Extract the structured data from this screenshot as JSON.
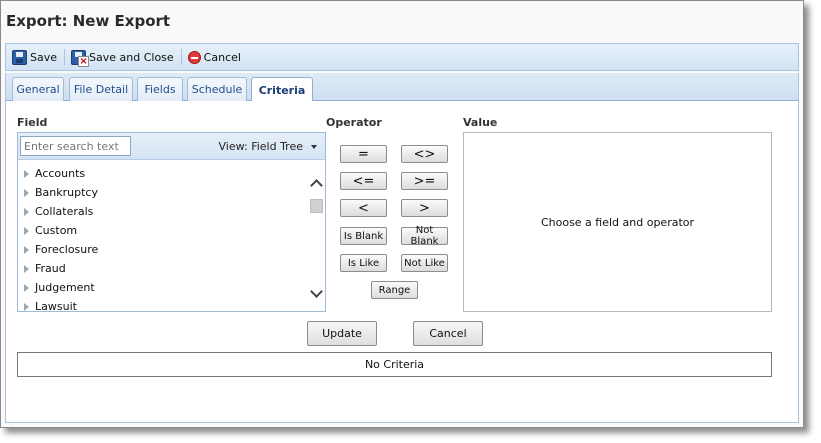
{
  "window": {
    "title": "Export: New Export"
  },
  "toolbar": {
    "save": {
      "label": "Save",
      "icon": "floppy-disk-icon"
    },
    "save_close": {
      "label": "Save and Close",
      "icon": "save-close-icon"
    },
    "cancel": {
      "label": "Cancel",
      "icon": "cancel-icon"
    }
  },
  "tabs": [
    {
      "label": "General",
      "active": false
    },
    {
      "label": "File Detail",
      "active": false
    },
    {
      "label": "Fields",
      "active": false
    },
    {
      "label": "Schedule",
      "active": false
    },
    {
      "label": "Criteria",
      "active": true
    }
  ],
  "field_section": {
    "label": "Field",
    "search_placeholder": "Enter search text",
    "search_value": "",
    "view_selector": "View: Field Tree",
    "items": [
      "Accounts",
      "Bankruptcy",
      "Collaterals",
      "Custom",
      "Foreclosure",
      "Fraud",
      "Judgement",
      "Lawsuit"
    ]
  },
  "operator_section": {
    "label": "Operator",
    "buttons": [
      "=",
      "<>",
      "<=",
      ">=",
      "<",
      ">",
      "Is Blank",
      "Not Blank",
      "Is Like",
      "Not Like",
      "Range"
    ]
  },
  "value_section": {
    "label": "Value",
    "message": "Choose a field and operator"
  },
  "actions": {
    "update": "Update",
    "cancel": "Cancel"
  },
  "criteria": {
    "message": "No Criteria"
  },
  "colors": {
    "toolbar_bg": "#d3e3f3",
    "tab_text": "#1f4e8a",
    "border_blue": "#a9c4df",
    "cancel_red": "#e03a3a"
  }
}
